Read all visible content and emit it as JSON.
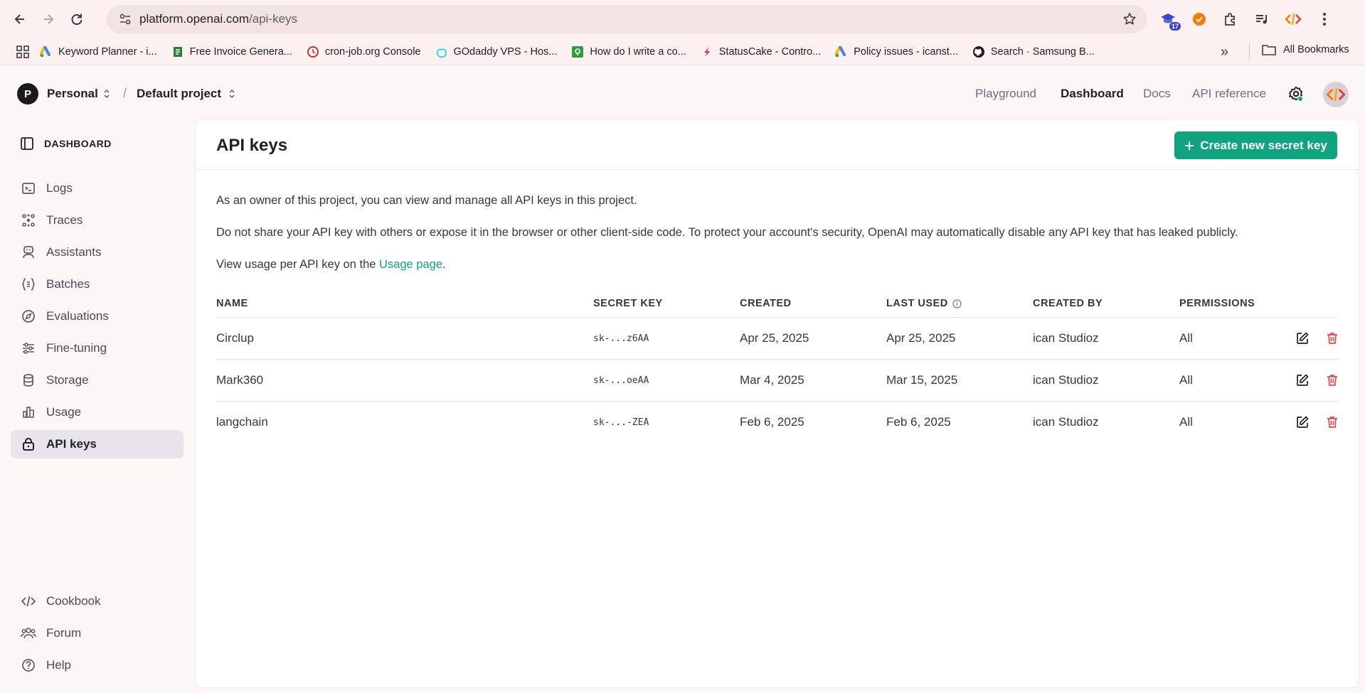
{
  "browser": {
    "url_host": "platform.openai.com",
    "url_path": "/api-keys",
    "extension_badge": "17"
  },
  "bookmarks": [
    {
      "label": "Keyword Planner - i...",
      "icon": "google-ads-icon"
    },
    {
      "label": "Free Invoice Genera...",
      "icon": "invoice-icon"
    },
    {
      "label": "cron-job.org Console",
      "icon": "cron-icon"
    },
    {
      "label": "GOdaddy VPS - Hos...",
      "icon": "godaddy-icon"
    },
    {
      "label": "How do I write a co...",
      "icon": "green-square-icon"
    },
    {
      "label": "StatusCake - Contro...",
      "icon": "statuscake-icon"
    },
    {
      "label": "Policy issues - icanst...",
      "icon": "google-ads-icon"
    },
    {
      "label": "Search · Samsung B...",
      "icon": "github-icon"
    }
  ],
  "bookmarks_all": "All Bookmarks",
  "header": {
    "org_initial": "P",
    "org_name": "Personal",
    "separator": "/",
    "project_name": "Default project",
    "nav": [
      "Playground",
      "Dashboard",
      "Docs",
      "API reference"
    ],
    "active_nav": "Dashboard"
  },
  "sidebar": {
    "heading": "DASHBOARD",
    "items": [
      {
        "label": "Logs",
        "icon": "terminal-icon"
      },
      {
        "label": "Traces",
        "icon": "traces-icon"
      },
      {
        "label": "Assistants",
        "icon": "assistant-icon"
      },
      {
        "label": "Batches",
        "icon": "batches-icon"
      },
      {
        "label": "Evaluations",
        "icon": "compass-icon"
      },
      {
        "label": "Fine-tuning",
        "icon": "sliders-icon"
      },
      {
        "label": "Storage",
        "icon": "database-icon"
      },
      {
        "label": "Usage",
        "icon": "bar-chart-icon"
      },
      {
        "label": "API keys",
        "icon": "lock-icon"
      }
    ],
    "footer": [
      {
        "label": "Cookbook",
        "icon": "code-icon"
      },
      {
        "label": "Forum",
        "icon": "people-icon"
      },
      {
        "label": "Help",
        "icon": "help-icon"
      }
    ]
  },
  "main": {
    "title": "API keys",
    "create_button": "Create new secret key",
    "para1": "As an owner of this project, you can view and manage all API keys in this project.",
    "para2": "Do not share your API key with others or expose it in the browser or other client-side code. To protect your account's security, OpenAI may automatically disable any API key that has leaked publicly.",
    "para3_pre": "View usage per API key on the ",
    "para3_link": "Usage page",
    "para3_post": ".",
    "columns": [
      "NAME",
      "SECRET KEY",
      "CREATED",
      "LAST USED",
      "CREATED BY",
      "PERMISSIONS"
    ],
    "rows": [
      {
        "name": "Circlup",
        "key": "sk-...z6AA",
        "created": "Apr 25, 2025",
        "last_used": "Apr 25, 2025",
        "created_by": "ican Studioz",
        "permissions": "All"
      },
      {
        "name": "Mark360",
        "key": "sk-...oeAA",
        "created": "Mar 4, 2025",
        "last_used": "Mar 15, 2025",
        "created_by": "ican Studioz",
        "permissions": "All"
      },
      {
        "name": "langchain",
        "key": "sk-...-ZEA",
        "created": "Feb 6, 2025",
        "last_used": "Feb 6, 2025",
        "created_by": "ican Studioz",
        "permissions": "All"
      }
    ]
  },
  "colors": {
    "accent": "#10a37f",
    "danger": "#e5484d",
    "browser_bg": "#fcf0f1"
  }
}
